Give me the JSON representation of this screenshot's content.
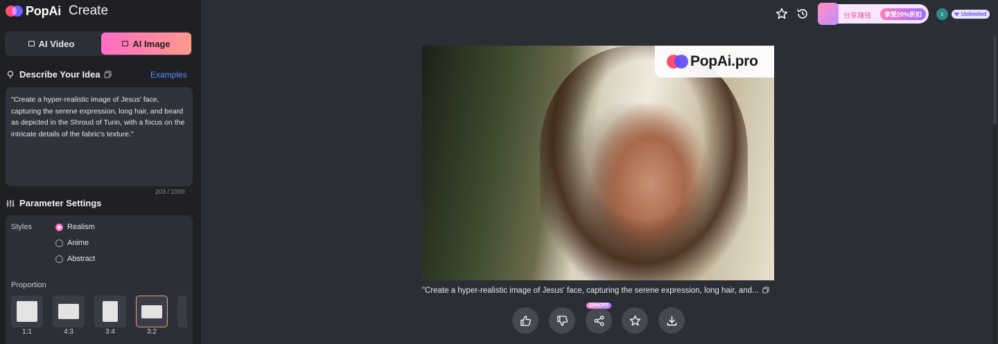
{
  "app": {
    "logo": "PopAi",
    "section": "Create"
  },
  "tabs": {
    "video": "AI Video",
    "image": "AI Image",
    "active": "image"
  },
  "describe": {
    "title": "Describe Your Idea",
    "examples_link": "Examples",
    "prompt": "\"Create a hyper-realistic image of Jesus' face, capturing the serene expression, long hair, and beard as depicted in the Shroud of Turin, with a focus on the intricate details of the fabric's texture.\"",
    "counter": "203 / 1000"
  },
  "params": {
    "title": "Parameter Settings",
    "styles_label": "Styles",
    "styles": [
      {
        "label": "Realism",
        "selected": true
      },
      {
        "label": "Anime",
        "selected": false
      },
      {
        "label": "Abstract",
        "selected": false
      }
    ],
    "proportion_label": "Proportion",
    "ratios": [
      {
        "label": "1:1",
        "selected": false
      },
      {
        "label": "4:3",
        "selected": false
      },
      {
        "label": "3:4",
        "selected": false
      },
      {
        "label": "3:2",
        "selected": true
      }
    ]
  },
  "topbar": {
    "icons": [
      "star-icon",
      "history-icon"
    ],
    "promo_text": "分享赚钱",
    "promo_badge": "享受20%折扣",
    "avatar_initial": "c",
    "plan_badge": "Unlimited"
  },
  "result": {
    "watermark": "PopAi.pro",
    "caption": "\"Create a hyper-realistic image of Jesus' face, capturing the serene expression, long hair, and...",
    "actions": [
      "thumbs-up-icon",
      "thumbs-down-icon",
      "share-icon",
      "star-icon",
      "download-icon"
    ],
    "share_badge": "20%OFF"
  },
  "colors": {
    "accent_gradient_start": "#ff6ec7",
    "accent_gradient_end": "#ff9a8a",
    "link": "#5a8bff",
    "sidebar_bg": "#1e2024",
    "main_bg": "#2b2e35"
  }
}
